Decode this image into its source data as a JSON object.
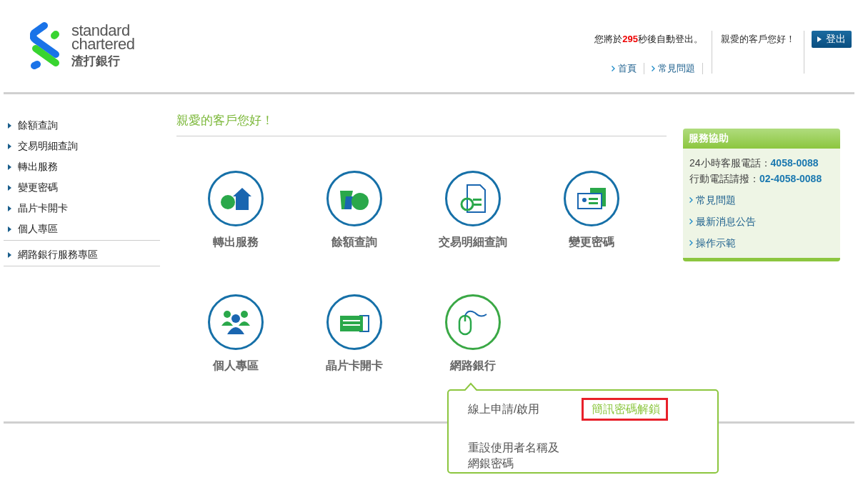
{
  "logo": {
    "line1": "standard",
    "line2": "chartered",
    "line3": "渣打銀行"
  },
  "header": {
    "countdown": {
      "before": "您將於",
      "seconds": "295",
      "after": "秒後自動登出。"
    },
    "greeting": "親愛的客戶您好！",
    "logout": "登出",
    "links": [
      "首頁",
      "常見問題"
    ]
  },
  "sidebar": {
    "items": [
      "餘額查詢",
      "交易明細查詢",
      "轉出服務",
      "變更密碼",
      "晶片卡開卡",
      "個人專區"
    ],
    "extra_items": [
      "網路銀行服務專區"
    ]
  },
  "main": {
    "heading": "親愛的客戶您好！",
    "tiles": [
      {
        "label": "轉出服務",
        "selected": false
      },
      {
        "label": "餘額查詢",
        "selected": false
      },
      {
        "label": "交易明細查詢",
        "selected": false
      },
      {
        "label": "變更密碼",
        "selected": false
      },
      {
        "label": "個人專區",
        "selected": false
      },
      {
        "label": "晶片卡開卡",
        "selected": false
      },
      {
        "label": "網路銀行",
        "selected": true
      }
    ],
    "popup": {
      "options": [
        {
          "label": "線上申請/啟用",
          "selected": false
        },
        {
          "label": "簡訊密碼解鎖",
          "selected": true
        },
        {
          "label": "重設使用者名稱及網銀密碼",
          "selected": false
        }
      ]
    }
  },
  "service_panel": {
    "title": "服務協助",
    "phones": [
      {
        "label": "24小時客服電話：",
        "number": "4058-0088"
      },
      {
        "label": "行動電話請撥：",
        "number": "02-4058-0088"
      }
    ],
    "links": [
      "常見問題",
      "最新消息公告",
      "操作示範"
    ]
  }
}
